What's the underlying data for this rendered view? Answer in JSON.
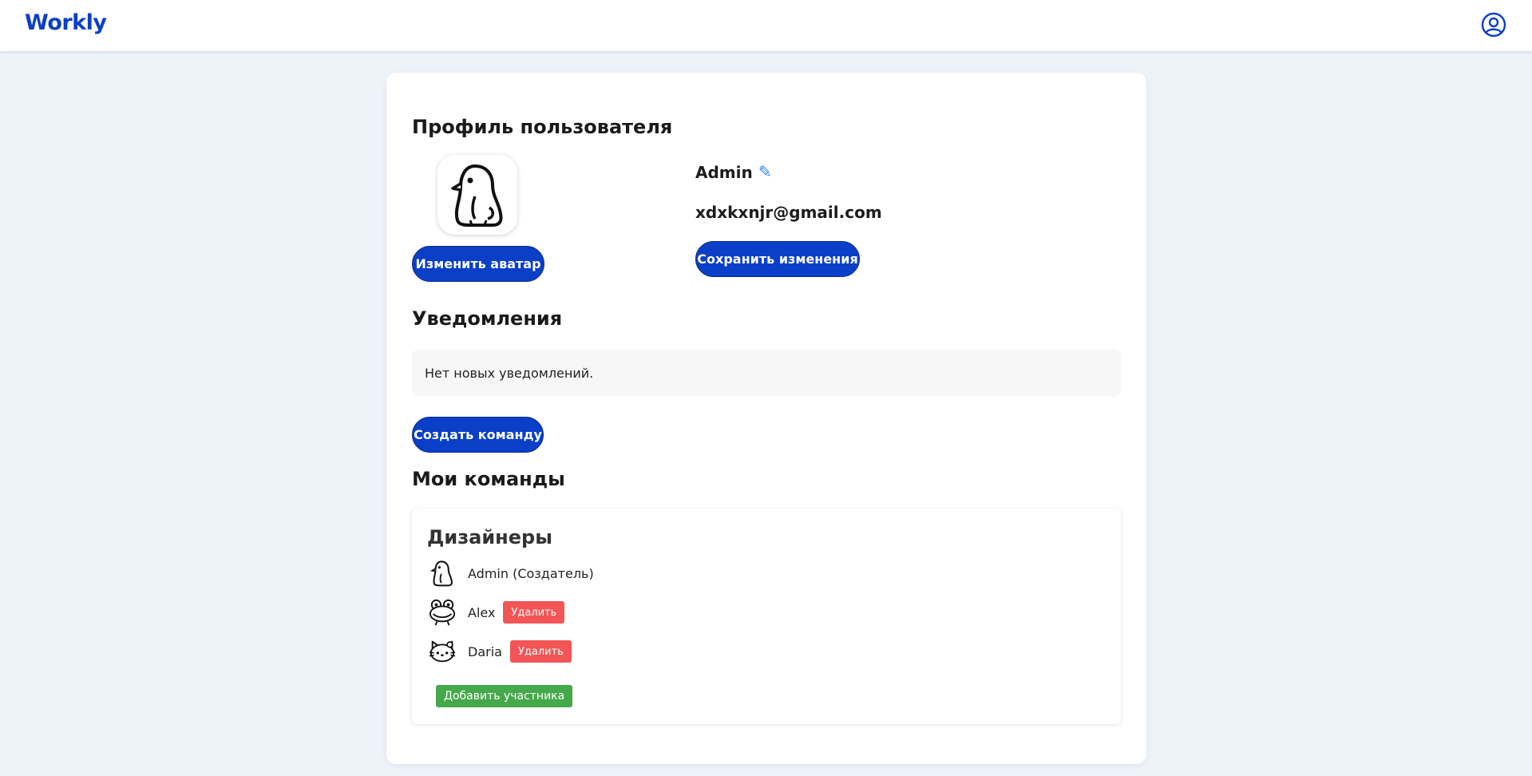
{
  "app": {
    "logo": "Workly"
  },
  "header": {
    "user_icon": "user-circle-icon"
  },
  "profile": {
    "title": "Профиль пользователя",
    "avatar_icon": "penguin-avatar",
    "change_avatar_label": "Изменить аватар",
    "username": "Admin",
    "edit_icon": "pencil-icon",
    "email": "xdxkxnjr@gmail.com",
    "save_label": "Сохранить изменения"
  },
  "notifications": {
    "title": "Уведомления",
    "empty_text": "Нет новых уведомлений."
  },
  "create_team_label": "Создать команду",
  "teams": {
    "title": "Мои команды",
    "items": [
      {
        "name": "Дизайнеры",
        "members": [
          {
            "name": "Admin (Создатель)",
            "avatar": "penguin-avatar"
          },
          {
            "name": "Alex",
            "avatar": "frog-avatar",
            "remove_label": "Удалить"
          },
          {
            "name": "Daria",
            "avatar": "cat-avatar",
            "remove_label": "Удалить"
          }
        ],
        "add_member_label": "Добавить участника"
      }
    ]
  },
  "colors": {
    "primary": "#0b3fc8",
    "danger": "#f25555",
    "success": "#45a84a",
    "background": "#eef2f9"
  }
}
